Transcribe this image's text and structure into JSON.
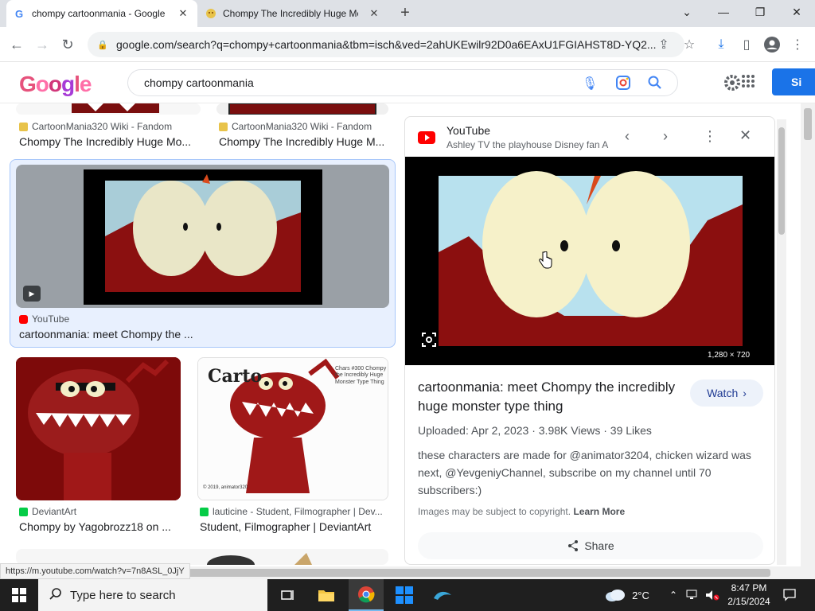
{
  "browser": {
    "tabs": [
      {
        "title": "chompy cartoonmania - Google S",
        "active": true
      },
      {
        "title": "Chompy The Incredibly Huge Mo",
        "active": false
      }
    ],
    "new_tab_symbol": "+",
    "url": "google.com/search?q=chompy+cartoonmania&tbm=isch&ved=2ahUKEwilr92D0a6EAxU1FGIAHST8D-YQ2..."
  },
  "google": {
    "logo_text": "Google",
    "query": "chompy cartoonmania",
    "sign_in": "Si"
  },
  "results": [
    {
      "source": "CartoonMania320 Wiki - Fandom",
      "title": "Chompy The Incredibly Huge Mo..."
    },
    {
      "source": "CartoonMania320 Wiki - Fandom",
      "title": "Chompy The Incredibly Huge M..."
    },
    {
      "source": "YouTube",
      "title": "cartoonmania: meet Chompy the ..."
    },
    {
      "source": "DeviantArt",
      "title": "Chompy by Yagobrozz18 on ..."
    },
    {
      "source": "lauticine - Student, Filmographer | Dev...",
      "title": "Student, Filmographer | DeviantArt"
    }
  ],
  "result4_overlay": {
    "logo": "Carto",
    "caption": "Chars #300 Chompy the Incredibly Huge Monster Type Thing",
    "copyright": "© 2019, animator320"
  },
  "panel": {
    "site": "YouTube",
    "channel": "Ashley TV the playhouse Disney fan A",
    "dimensions": "1,280 × 720",
    "title": "cartoonmania: meet Chompy the incredibly huge monster type thing",
    "watch": "Watch",
    "meta": "Uploaded: Apr 2, 2023 · 3.98K Views · 39 Likes",
    "description": "these characters are made for @animator3204, chicken wizard was next, @YevgeniyChannel, subscribe on my channel until 70 subscribers:)",
    "copyright_note": "Images may be subject to copyright.",
    "learn_more": "Learn More",
    "share": "Share"
  },
  "status_url": "https://m.youtube.com/watch?v=7n8ASL_0JjY",
  "taskbar": {
    "search_placeholder": "Type here to search",
    "temperature": "2°C",
    "time": "8:47 PM",
    "date": "2/15/2024"
  }
}
